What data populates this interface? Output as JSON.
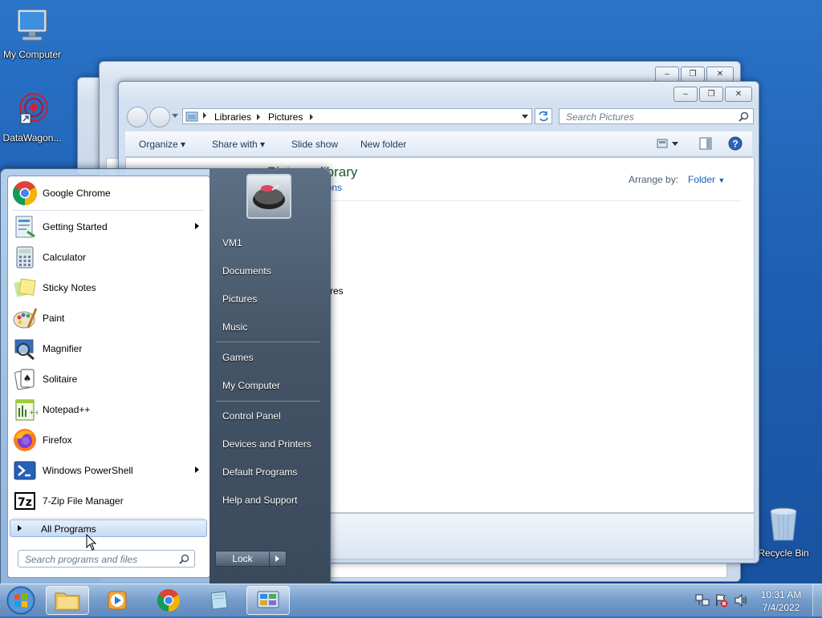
{
  "desktop": {
    "icons": [
      {
        "label": "My Computer"
      },
      {
        "label": "DataWagon..."
      },
      {
        "label": "Recycle Bin"
      }
    ]
  },
  "explorer": {
    "address": {
      "segments": [
        "Libraries",
        "Pictures"
      ]
    },
    "search_placeholder": "Search Pictures",
    "toolbar": {
      "organize": "Organize",
      "share_with": "Share with",
      "slide_show": "Slide show",
      "new_folder": "New folder"
    },
    "library_title": "Pictures library",
    "library_sub": "ations",
    "arrange_by_label": "Arrange by:",
    "arrange_by_value": "Folder",
    "partial_item": "res"
  },
  "start_menu": {
    "programs": [
      {
        "label": "Google Chrome",
        "icon": "chrome-icon",
        "submenu": false
      },
      {
        "label": "Getting Started",
        "icon": "getting-started-icon",
        "submenu": true
      },
      {
        "label": "Calculator",
        "icon": "calculator-icon",
        "submenu": false
      },
      {
        "label": "Sticky Notes",
        "icon": "sticky-notes-icon",
        "submenu": false
      },
      {
        "label": "Paint",
        "icon": "paint-icon",
        "submenu": false
      },
      {
        "label": "Magnifier",
        "icon": "magnifier-icon",
        "submenu": false
      },
      {
        "label": "Solitaire",
        "icon": "solitaire-icon",
        "submenu": false
      },
      {
        "label": "Notepad++",
        "icon": "notepadpp-icon",
        "submenu": false
      },
      {
        "label": "Firefox",
        "icon": "firefox-icon",
        "submenu": false
      },
      {
        "label": "Windows PowerShell",
        "icon": "powershell-icon",
        "submenu": true
      },
      {
        "label": "7-Zip File Manager",
        "icon": "7zip-icon",
        "submenu": false
      }
    ],
    "all_programs": "All Programs",
    "search_placeholder": "Search programs and files",
    "right_links": [
      "VM1",
      "Documents",
      "Pictures",
      "Music",
      "Games",
      "My Computer",
      "Control Panel",
      "Devices and Printers",
      "Default Programs",
      "Help and Support"
    ],
    "lock_label": "Lock"
  },
  "taskbar": {
    "clock_time": "10:31 AM",
    "clock_date": "7/4/2022"
  }
}
